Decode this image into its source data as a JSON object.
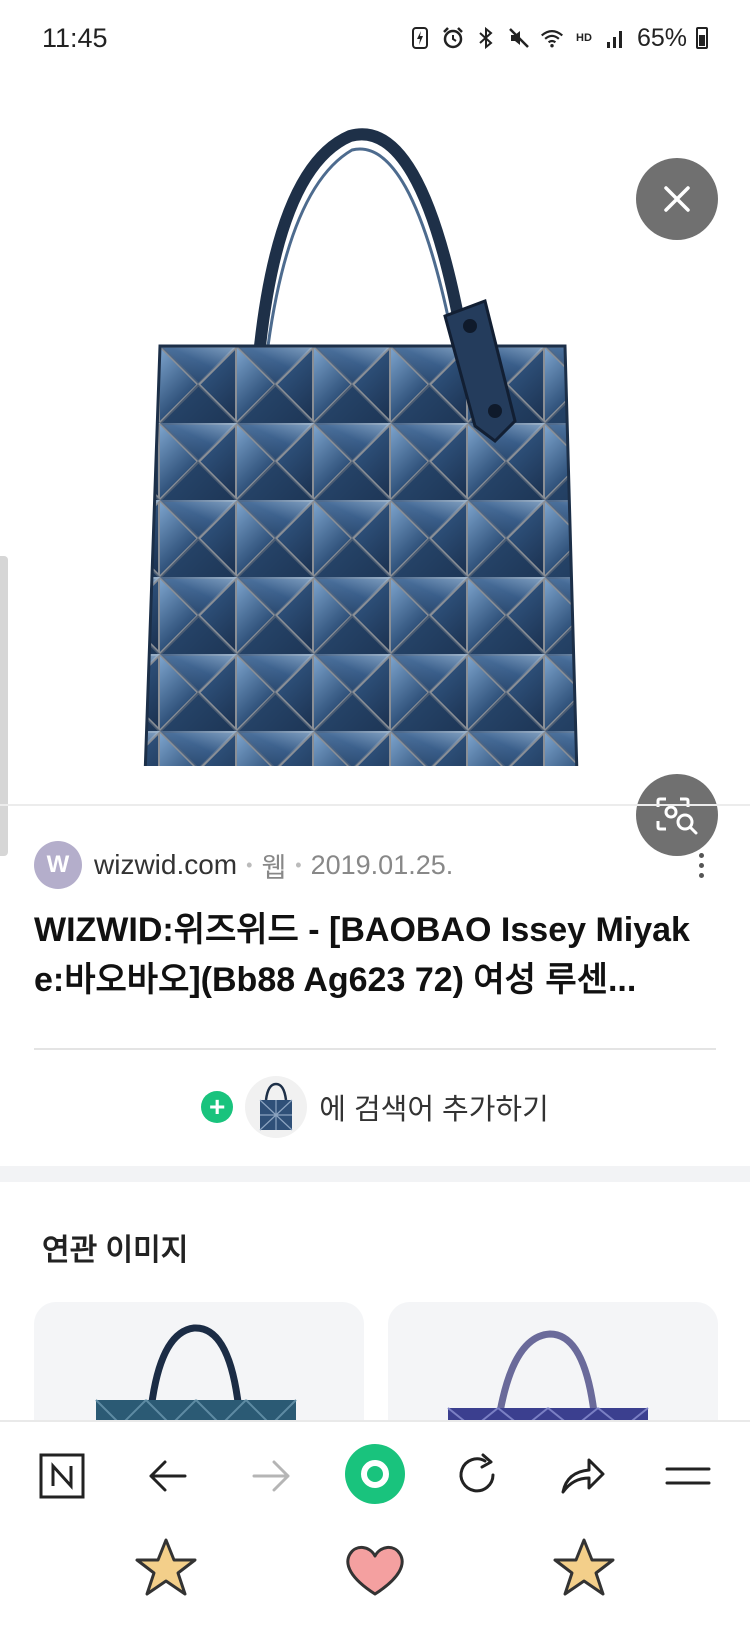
{
  "status_bar": {
    "time": "11:45",
    "hd_label": "HD",
    "battery": "65%"
  },
  "source": {
    "avatar_letter": "W",
    "domain": "wizwid.com",
    "type": "웹",
    "date": "2019.01.25."
  },
  "result": {
    "title": "WIZWID:위즈위드 - [BAOBAO Issey Miyake:바오바오](Bb88 Ag623 72) 여성 루센..."
  },
  "add_search": {
    "label": "에 검색어 추가하기"
  },
  "related": {
    "title": "연관 이미지"
  },
  "colors": {
    "accent_green": "#19c37d",
    "overlay_button": "#707070",
    "bag_navy": "#2b4668"
  },
  "icons": {
    "close": "close-icon",
    "lens": "image-search-icon",
    "more": "more-vertical-icon",
    "nav": [
      "naver-n-icon",
      "back-arrow-icon",
      "forward-arrow-icon",
      "green-dot-icon",
      "refresh-icon",
      "share-icon",
      "menu-icon"
    ],
    "emoji": [
      "star-icon",
      "heart-icon",
      "star-icon"
    ]
  }
}
